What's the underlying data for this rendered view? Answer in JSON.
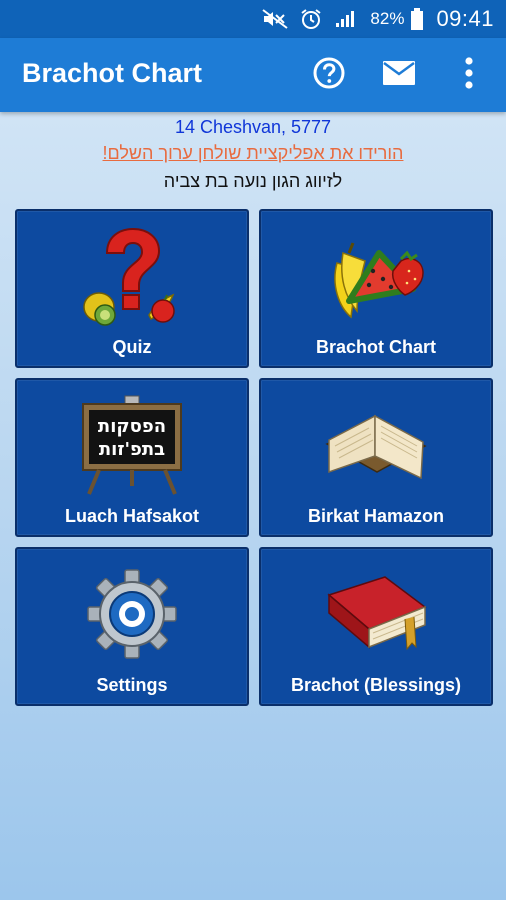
{
  "status_bar": {
    "battery_percent": "82%",
    "time": "09:41"
  },
  "app_bar": {
    "title": "Brachot Chart",
    "icons": [
      "help-icon",
      "mail-icon",
      "overflow-menu-icon"
    ]
  },
  "header": {
    "hebrew_date": "14 Cheshvan, 5777",
    "promo_link": "הורידו את אפליקציית שולחן ערוך השלם!",
    "dedication": "לזיווג הגון נועה בת צביה"
  },
  "tiles": [
    {
      "label": "Quiz",
      "icon": "quiz-icon"
    },
    {
      "label": "Brachot Chart",
      "icon": "fruits-icon"
    },
    {
      "label": "Luach Hafsakot",
      "icon": "chalkboard-icon",
      "board_text": [
        "הפסקות",
        "בתפ'זות"
      ]
    },
    {
      "label": "Birkat Hamazon",
      "icon": "open-book-icon"
    },
    {
      "label": "Settings",
      "icon": "gear-icon"
    },
    {
      "label": "Brachot (Blessings)",
      "icon": "red-book-icon"
    }
  ],
  "colors": {
    "status_bar": "#0f63b8",
    "app_bar": "#1e7cd6",
    "tile": "#0d4aa0",
    "date_text": "#1036d8",
    "promo_text": "#e86b3f"
  }
}
